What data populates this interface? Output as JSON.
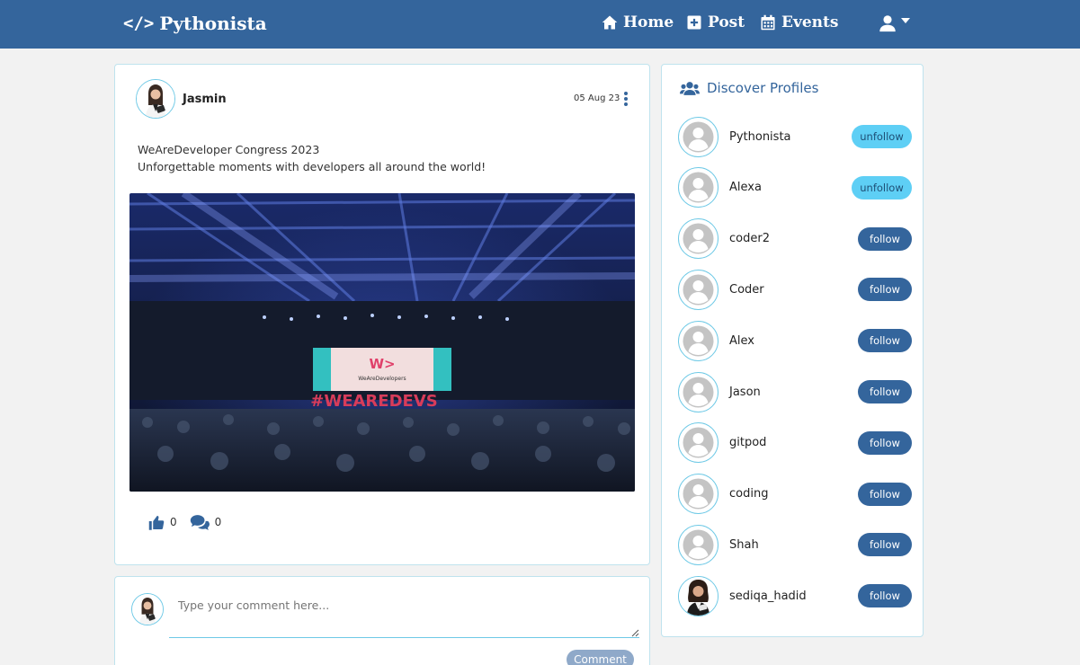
{
  "navbar": {
    "brand": "Pythonista",
    "links": {
      "home": "Home",
      "post": "Post",
      "events": "Events"
    },
    "icons": {
      "brand": "code-icon",
      "home": "home-icon",
      "post": "plus-square-icon",
      "events": "calendar-icon",
      "user": "user-icon"
    }
  },
  "post": {
    "author": "Jasmin",
    "date": "05 Aug 23",
    "text_line1": "WeAreDeveloper Congress 2023",
    "text_line2": "Unforgettable moments with developers all around the world!",
    "image_screen_text": "WeAreDevelopers",
    "image_floor_text": "#WEAREDEVS",
    "likes": "0",
    "comments": "0"
  },
  "comment_box": {
    "placeholder": "Type your comment here...",
    "button_label": "Comment"
  },
  "profiles": {
    "title": "Discover Profiles",
    "items": [
      {
        "name": "Pythonista",
        "action": "unfollow"
      },
      {
        "name": "Alexa",
        "action": "unfollow"
      },
      {
        "name": "coder2",
        "action": "follow"
      },
      {
        "name": "Coder",
        "action": "follow"
      },
      {
        "name": "Alex",
        "action": "follow"
      },
      {
        "name": "Jason",
        "action": "follow"
      },
      {
        "name": "gitpod",
        "action": "follow"
      },
      {
        "name": "coding",
        "action": "follow"
      },
      {
        "name": "Shah",
        "action": "follow"
      },
      {
        "name": "sediqa_hadid",
        "action": "follow"
      }
    ]
  },
  "colors": {
    "navbar": "#34659c",
    "follow_button": "#34659c",
    "unfollow_button": "#5ecff5",
    "card_border": "#bfe3ee"
  }
}
